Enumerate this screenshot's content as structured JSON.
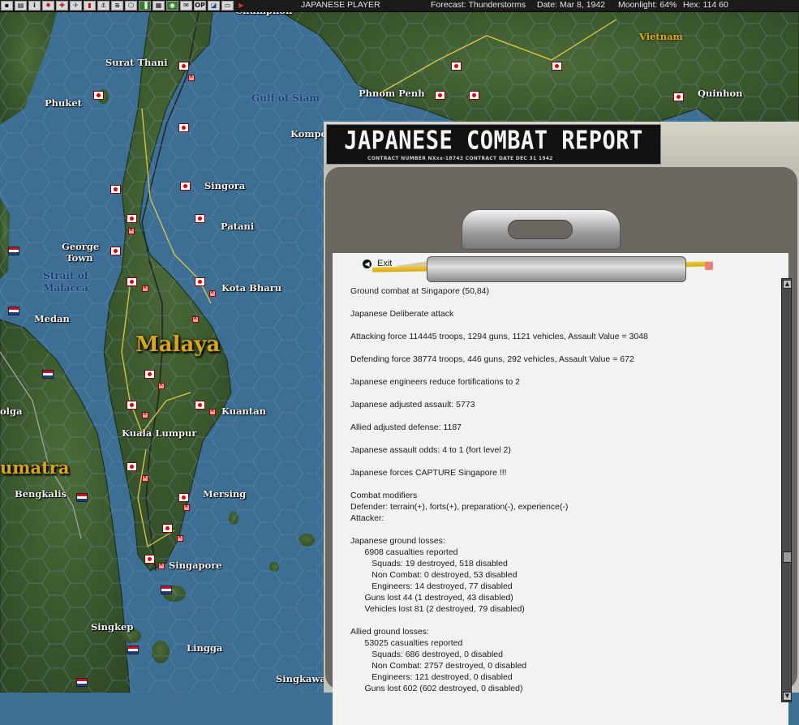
{
  "toolbar": {
    "icons": [
      "disk-icon",
      "printer-icon",
      "info-icon",
      "flag-icon",
      "aircraft-icon",
      "naval-icon",
      "flag-red-icon",
      "ground-icon",
      "map-icon",
      "hex-icon",
      "menu-icon",
      "overview-icon",
      "bridge-icon",
      "radar-icon",
      "ops-icon",
      "next-icon",
      "pen-icon",
      "play-icon"
    ],
    "player": "JAPANESE PLAYER",
    "forecast": "Forecast: Thunderstorms",
    "date": "Date: Mar 8, 1942",
    "moonlight": "Moonlight: 64%",
    "hex": "Hex: 114  60"
  },
  "map": {
    "labels": {
      "surat_thani": "Surat Thani",
      "phuket": "Phuket",
      "gulf_of_siam": "Gulf of Siam",
      "phnom_penh": "Phnom Penh",
      "vietnam": "Vietnam",
      "quinhon": "Quinhon",
      "kompong": "Kompo",
      "singora": "Singora",
      "patani": "Patani",
      "george_town": "George Town",
      "strait_of_malacca": "Strait of Malacca",
      "kota_bharu": "Kota Bharu",
      "medan": "Medan",
      "malaya": "Malaya",
      "kuantan": "Kuantan",
      "olga": "olga",
      "kuala_lumpur": "Kuala Lumpur",
      "sumatra": "umatra",
      "bengkalis": "Bengkalis",
      "mersing": "Mersing",
      "singapore": "Singapore",
      "singkep": "Singkep",
      "lingga": "Lingga",
      "singkawang": "Singkawa",
      "chumphon": "Chumphon"
    }
  },
  "report": {
    "title": "JAPANESE COMBAT REPORT",
    "contract_line": "CONTRACT NUMBER  NXxx-18743          CONTRACT DATE  DEC  31  1942",
    "exit_label": "Exit",
    "lines": [
      "Ground combat at Singapore (50,84)",
      "",
      "Japanese Deliberate attack",
      "",
      "Attacking force 114445 troops, 1294 guns, 1121 vehicles, Assault Value = 3048",
      "",
      "Defending force 38774 troops, 446 guns, 292 vehicles, Assault Value = 672",
      "",
      "Japanese engineers reduce fortifications to 2",
      "",
      "Japanese adjusted assault: 5773",
      "",
      "Allied adjusted defense: 1187",
      "",
      "Japanese assault odds: 4 to 1 (fort level 2)",
      "",
      "Japanese forces CAPTURE Singapore !!!",
      "",
      "Combat modifiers",
      "Defender: terrain(+), forts(+), preparation(-), experience(-)",
      "Attacker:",
      "",
      "Japanese ground losses:",
      "      6908 casualties reported",
      "         Squads: 19 destroyed, 518 disabled",
      "         Non Combat: 0 destroyed, 53 disabled",
      "         Engineers: 14 destroyed, 77 disabled",
      "      Guns lost 44 (1 destroyed, 43 disabled)",
      "      Vehicles lost 81 (2 destroyed, 79 disabled)",
      "",
      "Allied ground losses:",
      "      53025 casualties reported",
      "         Squads: 686 destroyed, 0 disabled",
      "         Non Combat: 2757 destroyed, 0 disabled",
      "         Engineers: 121 destroyed, 0 disabled",
      "      Guns lost 602 (602 destroyed, 0 disabled)"
    ]
  },
  "colors": {
    "sea": "#3d6e93",
    "land": "#3f5a30",
    "report_bg": "#c3c1bb",
    "paper": "#f2f2f2"
  }
}
